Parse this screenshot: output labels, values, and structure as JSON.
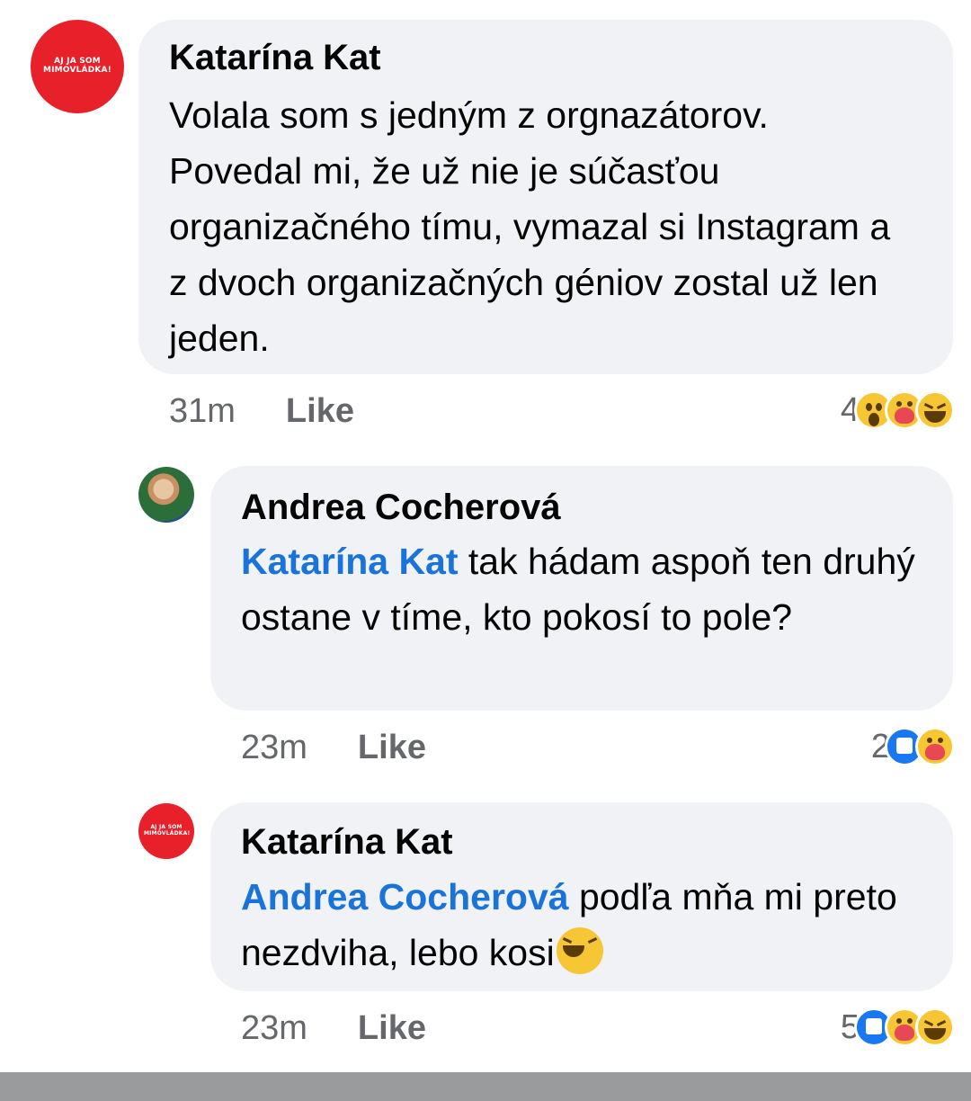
{
  "comments": [
    {
      "author": "Katarína Kat",
      "avatar_text": "AJ JA SOM MIMOVLÁDKA!",
      "mention": "",
      "text": "Volala som s jedným z orgnazátorov. Povedal mi, že už nie je súčasťou organizačného tímu, vymazal si Instagram a z dvoch organizačných géniov zostal už len jeden.",
      "time": "31m",
      "like_label": "Like",
      "reaction_count": "4",
      "reactions": [
        "wow-icon",
        "care-icon",
        "haha-icon"
      ]
    },
    {
      "author": "Andrea Cocherová",
      "avatar_text": "",
      "mention": "Katarína Kat",
      "text": " tak hádam aspoň ten druhý ostane v tíme, kto pokosí to pole?",
      "time": "23m",
      "like_label": "Like",
      "reaction_count": "2",
      "reactions": [
        "like-icon",
        "care-icon"
      ]
    },
    {
      "author": "Katarína Kat",
      "avatar_text": "AJ JA SOM MIMOVLÁDKA!",
      "mention": "Andrea Cocherová",
      "text": " podľa mňa mi preto nezdviha, lebo kosi",
      "inline_emoji": "laughing-emoji-icon",
      "time": "23m",
      "like_label": "Like",
      "reaction_count": "5",
      "reactions": [
        "like-icon",
        "care-icon",
        "haha-icon"
      ]
    }
  ],
  "colors": {
    "mention": "#1a73d8",
    "bubble": "#f0f2f5",
    "avatar_red": "#e8202a",
    "meta": "#65676b"
  }
}
